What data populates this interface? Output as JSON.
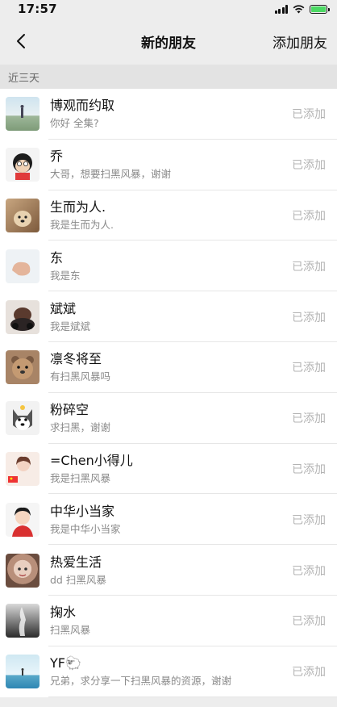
{
  "status_bar": {
    "time": "17:57"
  },
  "nav": {
    "title": "新的朋友",
    "action": "添加朋友"
  },
  "section": {
    "header": "近三天"
  },
  "items": [
    {
      "name": "博观而约取",
      "message": "你好 全集?",
      "status": "已添加"
    },
    {
      "name": "乔",
      "message": "大哥，想要扫黑风暴，谢谢",
      "status": "已添加"
    },
    {
      "name": "生而为人.",
      "message": "我是生而为人.",
      "status": "已添加"
    },
    {
      "name": "东",
      "message": "我是东",
      "status": "已添加"
    },
    {
      "name": "斌斌",
      "message": "我是斌斌",
      "status": "已添加"
    },
    {
      "name": "凛冬将至",
      "message": "有扫黑风暴吗",
      "status": "已添加"
    },
    {
      "name": "粉碎空",
      "message": "求扫黑，谢谢",
      "status": "已添加"
    },
    {
      "name": "=Chen小得儿",
      "message": "我是扫黑风暴",
      "status": "已添加"
    },
    {
      "name": "中华小当家",
      "message": "我是中华小当家",
      "status": "已添加"
    },
    {
      "name": "热爱生活",
      "message": "dd 扫黑风暴",
      "status": "已添加"
    },
    {
      "name": "掬水",
      "message": "扫黑风暴",
      "status": "已添加"
    },
    {
      "name": "YF🐑",
      "message": "兄弟，求分享一下扫黑风暴的资源，谢谢",
      "status": "已添加"
    }
  ],
  "colors": {
    "background": "#ededed",
    "list_bg": "#ffffff",
    "status_text": "#b3b3b3",
    "battery": "#4cd964"
  }
}
